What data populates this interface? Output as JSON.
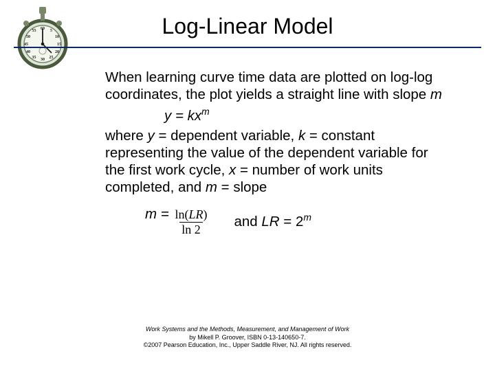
{
  "title": "Log-Linear Model",
  "body": {
    "p1": "When learning curve time data are plotted on log-log coordinates, the plot yields a straight line with slope ",
    "slope_var": "m",
    "eq1_base": "y = kx",
    "eq1_exp": "m",
    "p2a": "where ",
    "p2b": " = dependent variable, ",
    "p2c": " = constant representing the value of the dependent variable for the first work cycle, ",
    "p2d": " = number of work units completed, and ",
    "p2e": " = slope",
    "y": "y",
    "k": "k",
    "x": "x",
    "m": "m",
    "mline_lhs": "m = ",
    "frac_num_a": "ln",
    "frac_num_b": "(",
    "frac_num_c": "LR",
    "frac_num_d": ")",
    "frac_den": "ln 2",
    "mline_rhs_a": "and ",
    "mline_rhs_b": "LR",
    "mline_rhs_c": " = 2",
    "mline_rhs_exp": "m"
  },
  "footer": {
    "l1": "Work Systems and the Methods, Measurement, and Management of Work",
    "l2": "by Mikell P. Groover, ISBN 0-13-140650-7.",
    "l3": "©2007 Pearson Education, Inc., Upper Saddle River, NJ.  All rights reserved."
  }
}
